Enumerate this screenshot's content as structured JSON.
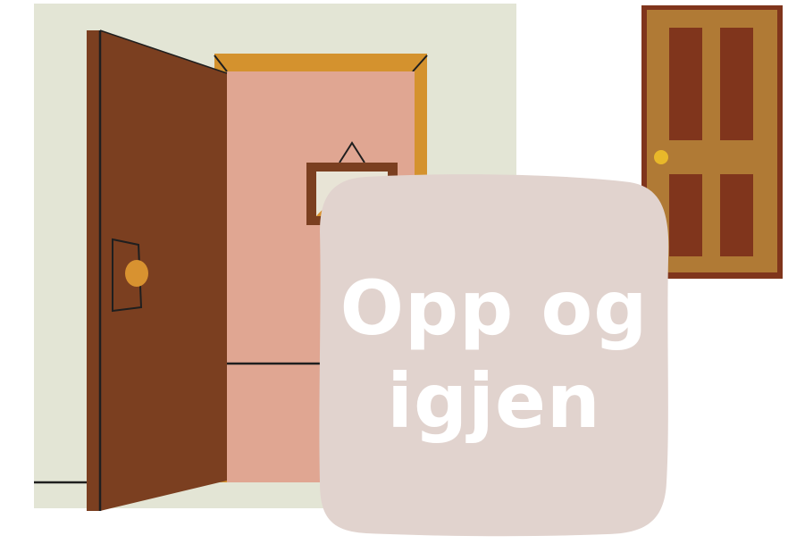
{
  "title": {
    "line1": "Opp og",
    "line2": "igjen"
  },
  "colors": {
    "wall": "#e3e5d5",
    "open_door": "#7b3f20",
    "room_interior": "#e0a692",
    "door_frame": "#d4922e",
    "doorknob": "#d89230",
    "picture_frame": "#7b3f20",
    "picture_glass": "#e8e4d6",
    "closed_door": "#b07a35",
    "closed_door_panel": "#80351c",
    "closed_door_knob": "#e8b82a",
    "card": "#e1d3ce",
    "title_text": "#ffffff"
  },
  "icons": {
    "open_door": "open-door-icon",
    "closed_door": "closed-door-icon",
    "picture": "framed-picture-icon"
  }
}
